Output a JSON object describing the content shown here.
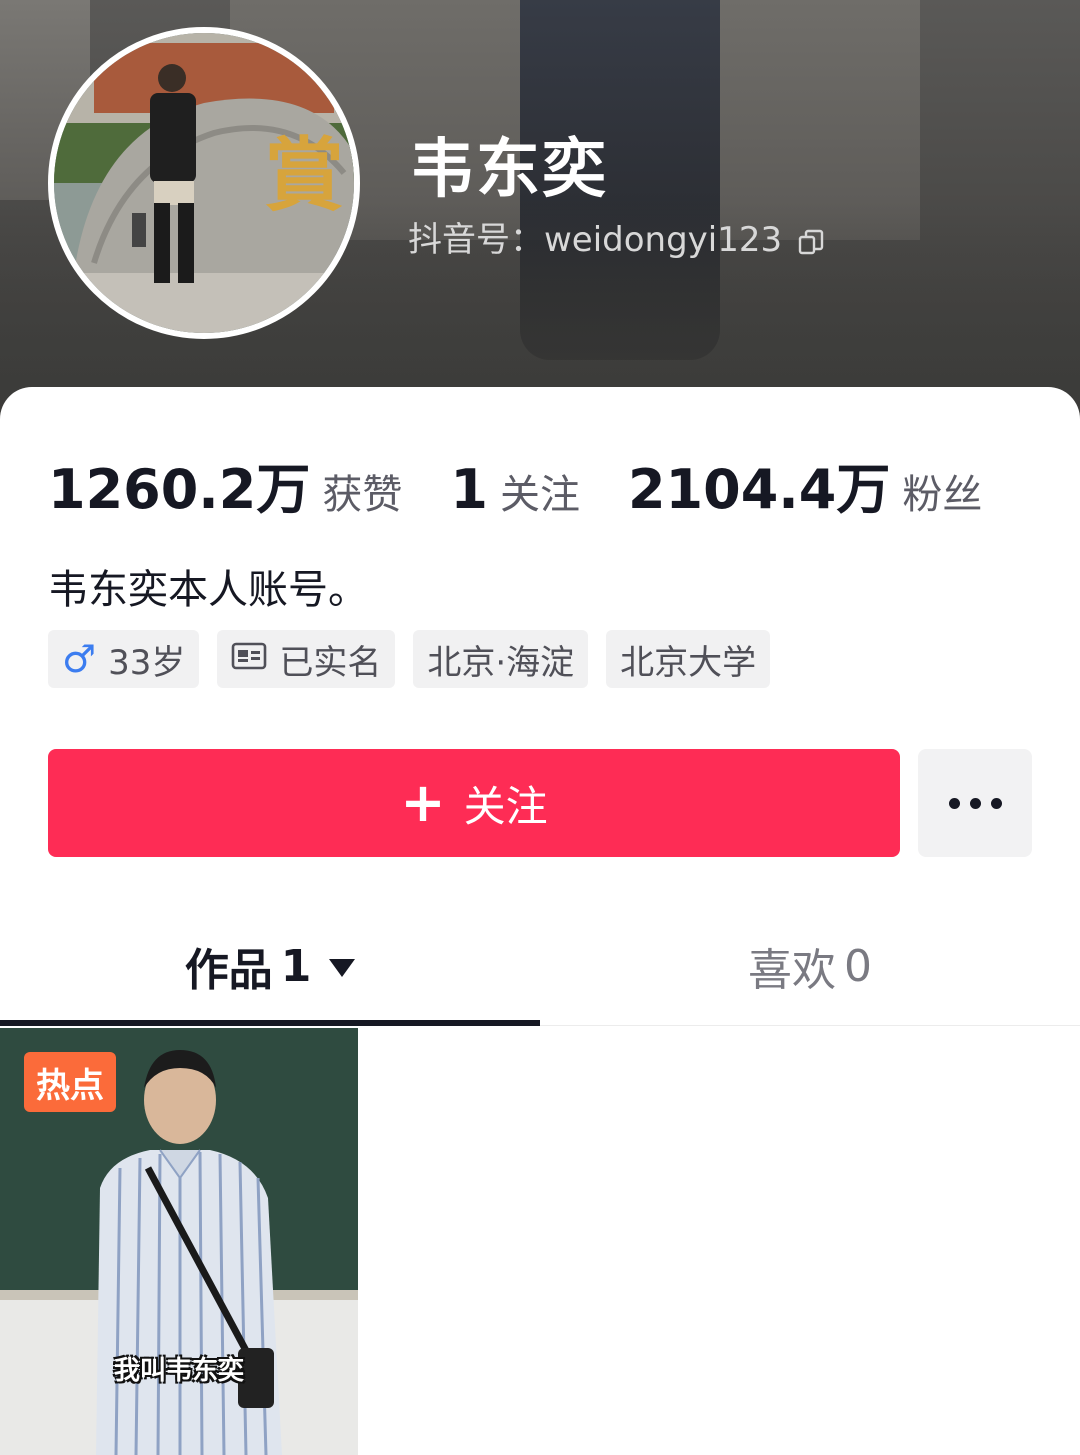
{
  "profile": {
    "name": "韦东奕",
    "douyin_id": "抖音号：weidongyi123",
    "bio": "韦东奕本人账号。"
  },
  "stats": {
    "likes_count": "1260.2万",
    "likes_label": "获赞",
    "following_count": "1",
    "following_label": "关注",
    "followers_count": "2104.4万",
    "followers_label": "粉丝"
  },
  "tags": {
    "age": "33岁",
    "verified": "已实名",
    "location": "北京·海淀",
    "school": "北京大学"
  },
  "actions": {
    "follow_label": "关注"
  },
  "tabs": {
    "works_label": "作品",
    "works_count": "1",
    "likes_label": "喜欢",
    "likes_count": "0"
  },
  "videos": [
    {
      "badge": "热点",
      "caption": "我叫韦东奕"
    }
  ],
  "colors": {
    "primary_red": "#fe2c55",
    "hot_badge": "#fb6b3a",
    "gender_blue": "#3c7df0",
    "text_dark": "#161823"
  }
}
